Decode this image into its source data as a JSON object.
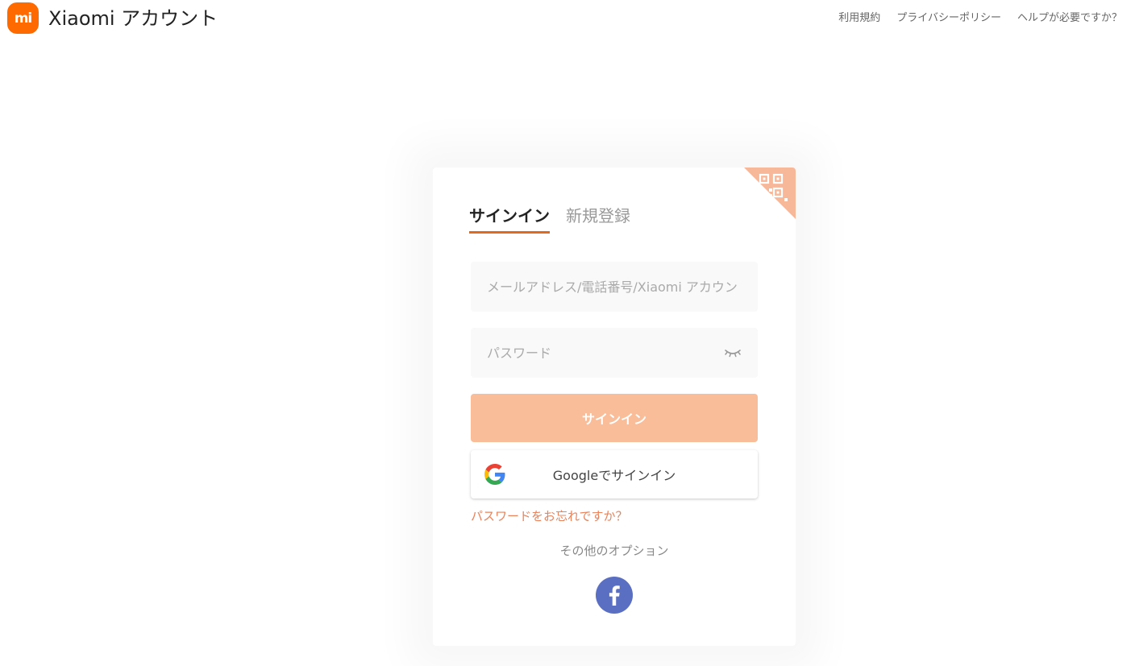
{
  "header": {
    "logo_text": "mi",
    "title": "Xiaomi アカウント",
    "links": [
      "利用規約",
      "プライバシーポリシー",
      "ヘルプが必要ですか？"
    ]
  },
  "card": {
    "tabs": [
      {
        "label": "サインイン",
        "active": true
      },
      {
        "label": "新規登録",
        "active": false
      }
    ],
    "username_field": {
      "placeholder": "メールアドレス/電話番号/Xiaomi アカウント",
      "value": ""
    },
    "password_field": {
      "placeholder": "パスワード",
      "value": ""
    },
    "signin_button_label": "サインイン",
    "google_button_label": "Googleでサインイン",
    "forgot_password": "パスワードをお忘れですか？",
    "other_options": "その他のオプション",
    "social_icons": [
      "facebook-icon"
    ],
    "corner_icon": "qr-code-icon"
  },
  "colors": {
    "brand_orange": "#ff6a00",
    "tab_underline": "#e0691f",
    "signin_button": "#f9bd9a",
    "qr_corner": "#f7b89a",
    "forgot_link": "#e9835b",
    "facebook": "#5b6fc2"
  }
}
